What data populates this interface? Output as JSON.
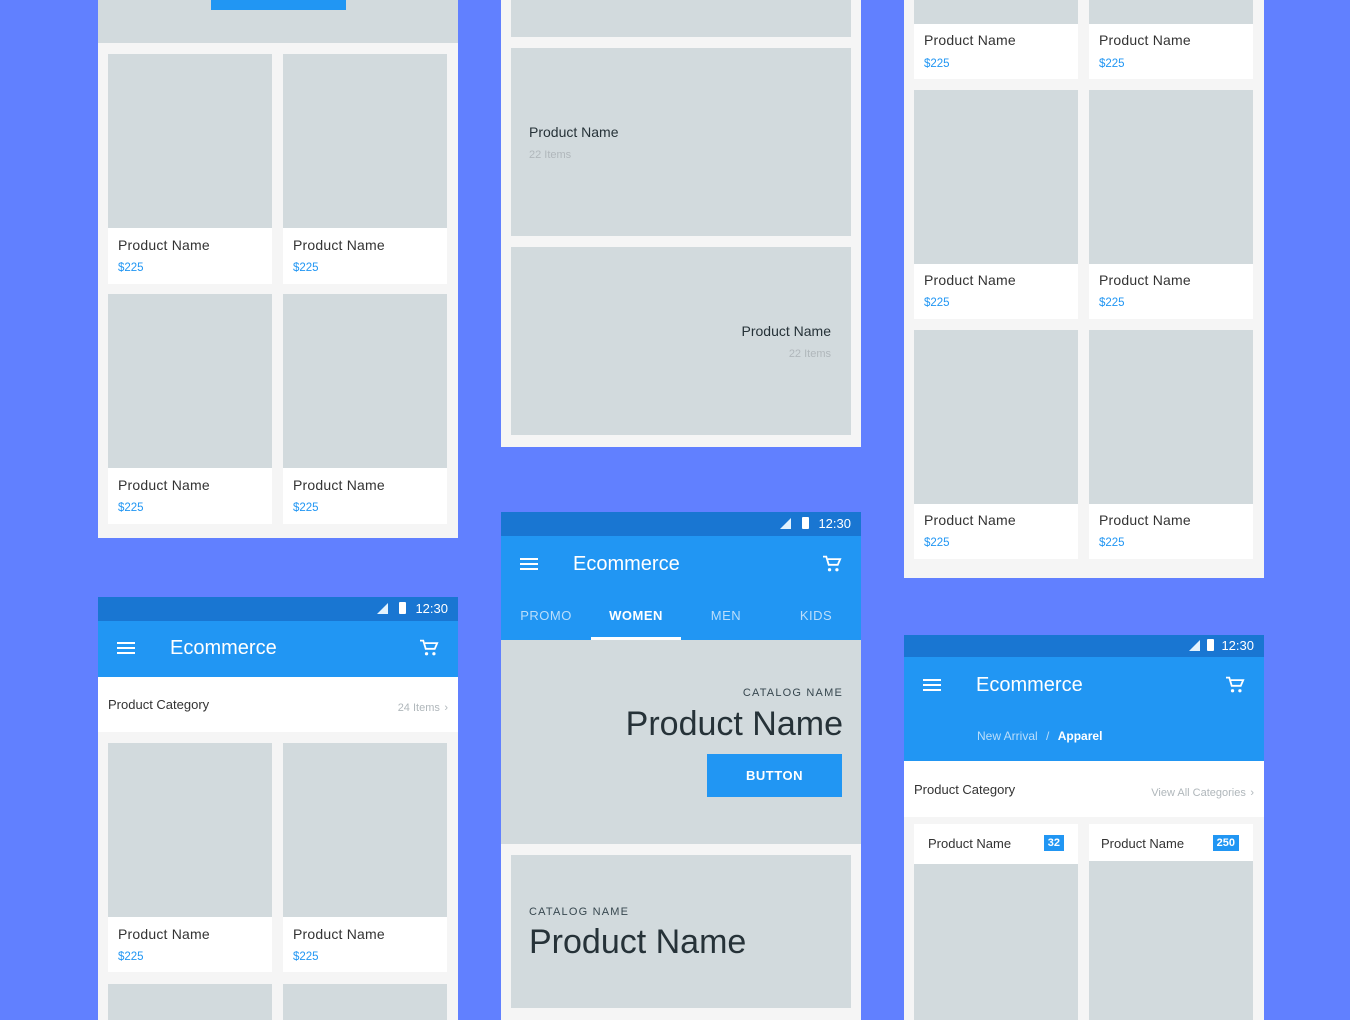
{
  "product": {
    "name": "Product Name",
    "price": "$225",
    "items": "22 Items"
  },
  "app": {
    "title": "Ecommerce",
    "time": "12:30"
  },
  "screen1": {
    "button_label": ""
  },
  "screen4": {
    "category_label": "Product Category",
    "category_count": "24 Items"
  },
  "screen5": {
    "tabs": [
      "PROMO",
      "WOMEN",
      "MEN",
      "KIDS"
    ],
    "active_tab": "WOMEN",
    "catalog_label": "CATALOG NAME",
    "hero_title": "Product Name",
    "button_label": "BUTTON"
  },
  "screen6": {
    "breadcrumb": [
      "New Arrival",
      "Apparel"
    ],
    "breadcrumb_sep": "/",
    "category_label": "Product Category",
    "view_all": "View All Categories",
    "badges": [
      "32",
      "250"
    ]
  },
  "icons": {
    "chevron": "chevron-right-icon",
    "menu": "menu-icon",
    "cart": "cart-icon"
  },
  "colors": {
    "background": "#6180FF",
    "primary": "#2196F3",
    "primary_dark": "#1976D2",
    "placeholder": "#D2DADD",
    "price": "#2196F3"
  }
}
